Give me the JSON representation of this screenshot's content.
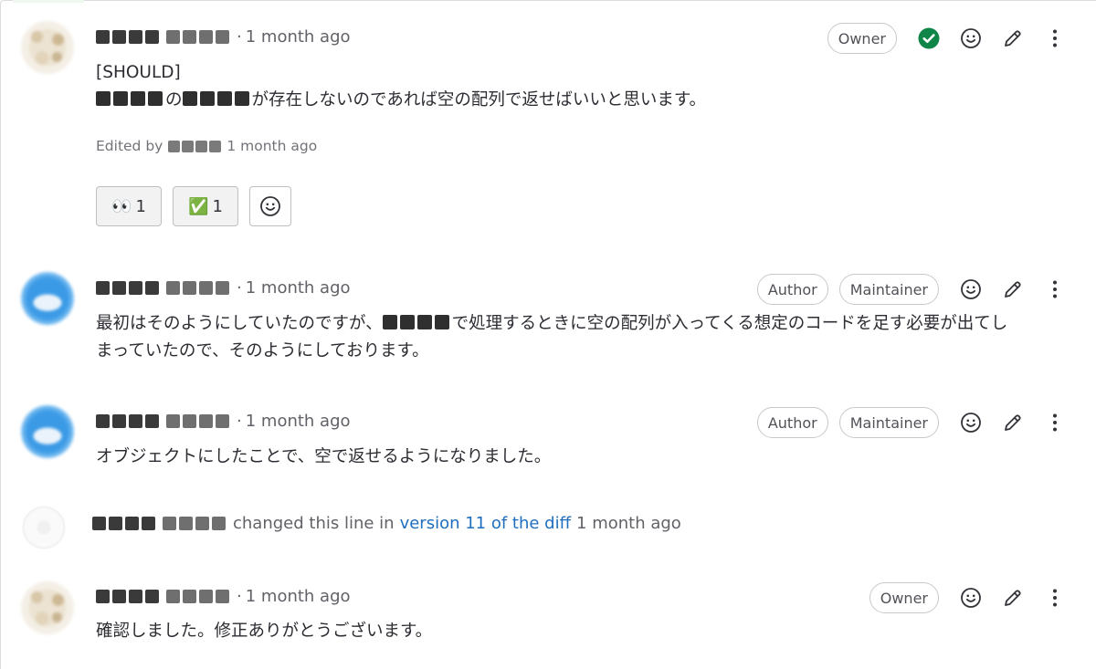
{
  "time_ago": "1 month ago",
  "separator": "·",
  "notes": [
    {
      "id": "note-1",
      "badges": [
        "Owner"
      ],
      "resolved": true,
      "lines": [
        "[SHOULD]",
        "のが存在しないのであれば空の配列で返せばいいと思います。"
      ],
      "edited_label": "Edited by",
      "reactions": [
        {
          "emoji": "👀",
          "count": "1"
        },
        {
          "emoji": "✅",
          "count": "1"
        }
      ]
    },
    {
      "id": "note-2",
      "badges": [
        "Author",
        "Maintainer"
      ],
      "line1_after": "で処理するときに空の配列が入ってくる想定のコードを足す必要が出てし",
      "line1_before": "最初はそのようにしていたのですが、",
      "line2": "まっていたので、そのようにしております。"
    },
    {
      "id": "note-3",
      "badges": [
        "Author",
        "Maintainer"
      ],
      "line1": "オブジェクトにしたことで、空で返せるようになりました。"
    },
    {
      "id": "system-note",
      "text_before": "changed this line in",
      "link": "version 11 of the diff"
    },
    {
      "id": "note-4",
      "badges": [
        "Owner"
      ],
      "line1": "確認しました。修正ありがとうございます。"
    }
  ],
  "icons": {
    "resolved": "check-circle-icon",
    "emoji": "smiley-icon",
    "edit": "pencil-icon",
    "more": "kebab-icon"
  },
  "colors": {
    "resolved": "#108548",
    "link": "#1f6fbf"
  }
}
